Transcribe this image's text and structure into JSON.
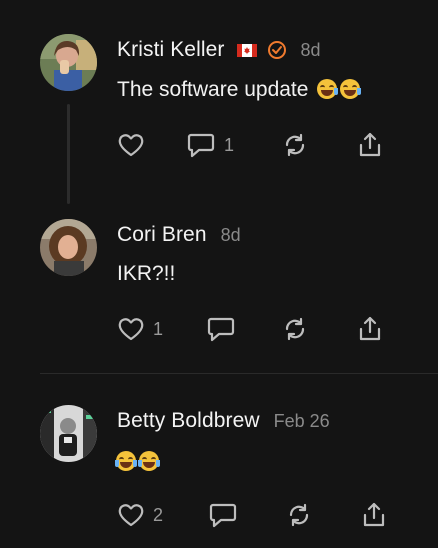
{
  "posts": [
    {
      "name": "Kristi Keller",
      "time": "8d",
      "text": "The software update",
      "emoji": [
        "rolling-on-floor-laughing-emoji",
        "rolling-on-floor-laughing-emoji"
      ],
      "like_count": "",
      "comment_count": "1"
    },
    {
      "name": "Cori Bren",
      "time": "8d",
      "text": "IKR?!!",
      "like_count": "1",
      "comment_count": ""
    },
    {
      "name": "Betty Boldbrew",
      "time": "Feb 26",
      "text": "",
      "emoji": [
        "tears-of-joy-emoji",
        "tears-of-joy-emoji"
      ],
      "like_count": "2",
      "comment_count": ""
    }
  ],
  "colors": {
    "background": "#141414",
    "verified_accent": "#f07a2e",
    "muted": "#8a8a8a",
    "icon": "#bdbdbd"
  }
}
